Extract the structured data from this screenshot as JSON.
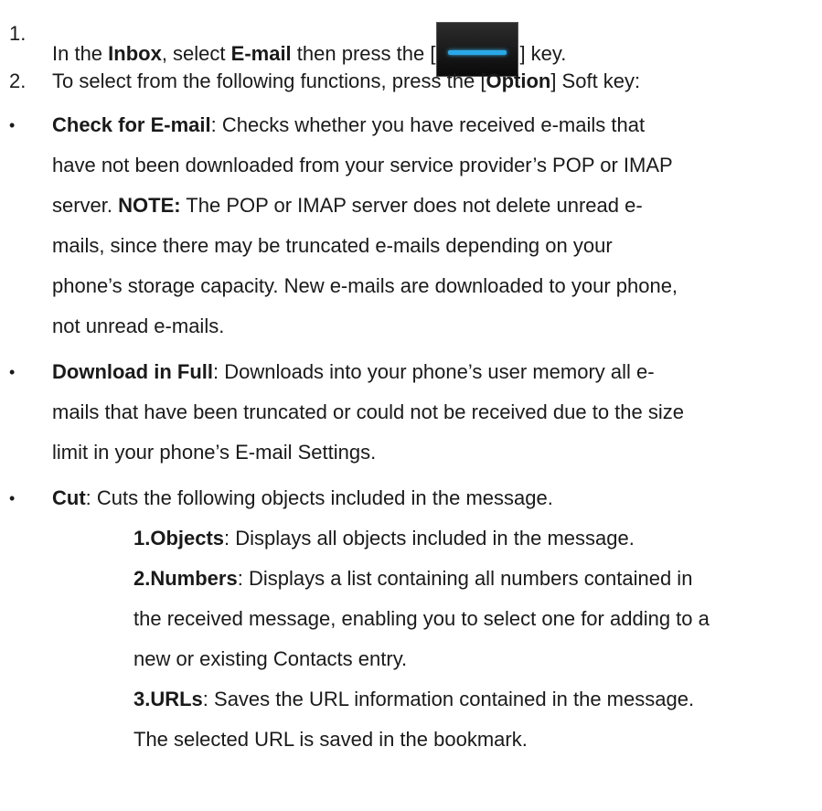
{
  "step1": {
    "number": "1.",
    "pre": "In the ",
    "inbox": "Inbox",
    "mid": ", select ",
    "email": "E-mail",
    "post": " then press the [",
    "key_icon": "menu-key-icon",
    "end": "] key."
  },
  "step2": {
    "number": "2.",
    "pre": "To select from the following functions, press the [",
    "option": "Option",
    "post": "] Soft key:"
  },
  "bullet_char": "•",
  "check": {
    "term": "Check for E-mail",
    "l1": ": Checks whether you have received e-mails that",
    "l2": "have not been downloaded from your service provider’s POP or IMAP",
    "l3_pre": "server. ",
    "note": "NOTE:",
    "l3_post": " The POP or IMAP server does not delete unread e-",
    "l4": "mails, since there may be truncated e-mails depending on your",
    "l5": "phone’s storage capacity. New e-mails are downloaded to your phone,",
    "l6": "not unread e-mails."
  },
  "download": {
    "term": "Download in Full",
    "l1": ": Downloads into your phone’s user memory all e-",
    "l2": "mails that have been truncated or could not be received due to the size",
    "l3": "limit in your phone’s E-mail Settings."
  },
  "cut": {
    "term": "Cut",
    "l1": ": Cuts the following objects included in the message.",
    "objects_term": "1.Objects",
    "objects_text": ": Displays all objects included in the message.",
    "numbers_term": "2.Numbers",
    "numbers_l1": ": Displays a list containing all numbers contained in",
    "numbers_l2": "the received message, enabling you to select one for adding to a",
    "numbers_l3": "new or existing Contacts entry.",
    "urls_term": "3.URLs",
    "urls_l1": ": Saves the URL information contained in the message.",
    "urls_l2": "The selected URL is saved in the bookmark."
  }
}
